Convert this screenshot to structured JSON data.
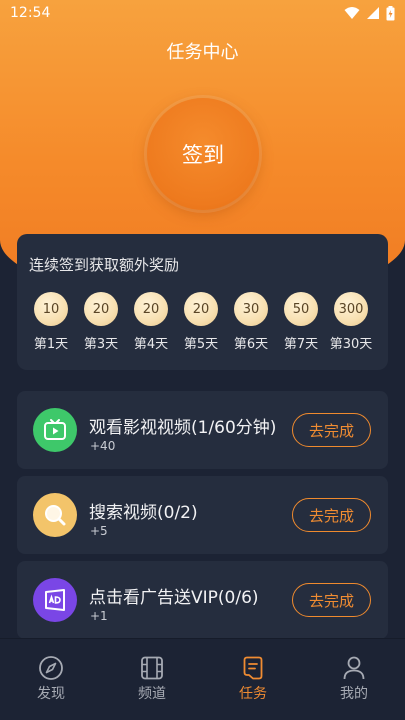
{
  "status_bar": {
    "time": "12:54"
  },
  "header": {
    "title": "任务中心"
  },
  "checkin": {
    "label": "签到"
  },
  "streak": {
    "title": "连续签到获取额外奖励",
    "days": [
      {
        "points": "10",
        "label": "第1天"
      },
      {
        "points": "20",
        "label": "第3天"
      },
      {
        "points": "20",
        "label": "第4天"
      },
      {
        "points": "20",
        "label": "第5天"
      },
      {
        "points": "30",
        "label": "第6天"
      },
      {
        "points": "50",
        "label": "第7天"
      },
      {
        "points": "300",
        "label": "第30天"
      }
    ]
  },
  "tasks": [
    {
      "title": "观看影视视频(1/60分钟)",
      "reward": "+40",
      "button": "去完成",
      "icon": "tv-icon",
      "color": "#3ec86a"
    },
    {
      "title": "搜索视频(0/2)",
      "reward": "+5",
      "button": "去完成",
      "icon": "search-icon",
      "color": "#f3c46a"
    },
    {
      "title": "点击看广告送VIP(0/6)",
      "reward": "+1",
      "button": "去完成",
      "icon": "ad-icon",
      "color": "#7a46e6"
    }
  ],
  "tabbar": {
    "items": [
      {
        "label": "发现",
        "icon": "compass-icon",
        "active": false
      },
      {
        "label": "频道",
        "icon": "film-icon",
        "active": false
      },
      {
        "label": "任务",
        "icon": "task-list-icon",
        "active": true
      },
      {
        "label": "我的",
        "icon": "user-icon",
        "active": false
      }
    ]
  },
  "colors": {
    "accent": "#f08c32",
    "card": "#252d3e",
    "background": "#1c2334"
  }
}
